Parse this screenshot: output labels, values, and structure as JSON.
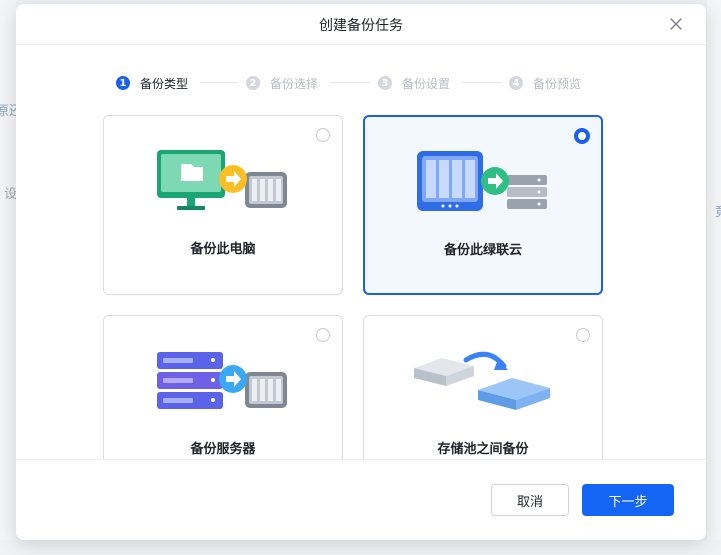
{
  "dialog": {
    "title": "创建备份任务"
  },
  "steps": [
    {
      "num": "1",
      "label": "备份类型"
    },
    {
      "num": "2",
      "label": "备份选择"
    },
    {
      "num": "3",
      "label": "备份设置"
    },
    {
      "num": "4",
      "label": "备份预览"
    }
  ],
  "active_step": 1,
  "cards": [
    {
      "label": "备份此电脑",
      "icon": "computer-to-nas-icon",
      "selected": false
    },
    {
      "label": "备份此绿联云",
      "icon": "nas-to-server-icon",
      "selected": true
    },
    {
      "label": "备份服务器",
      "icon": "server-to-nas-icon",
      "selected": false
    },
    {
      "label": "存储池之间备份",
      "icon": "pool-to-pool-icon",
      "selected": false
    }
  ],
  "footer": {
    "cancel_label": "取消",
    "next_label": "下一步"
  },
  "background_fragments": {
    "left_top": "原还",
    "left_mid": "设",
    "right": "竟"
  },
  "colors": {
    "accent": "#1a5ff0",
    "primary_button": "#1565f5"
  }
}
